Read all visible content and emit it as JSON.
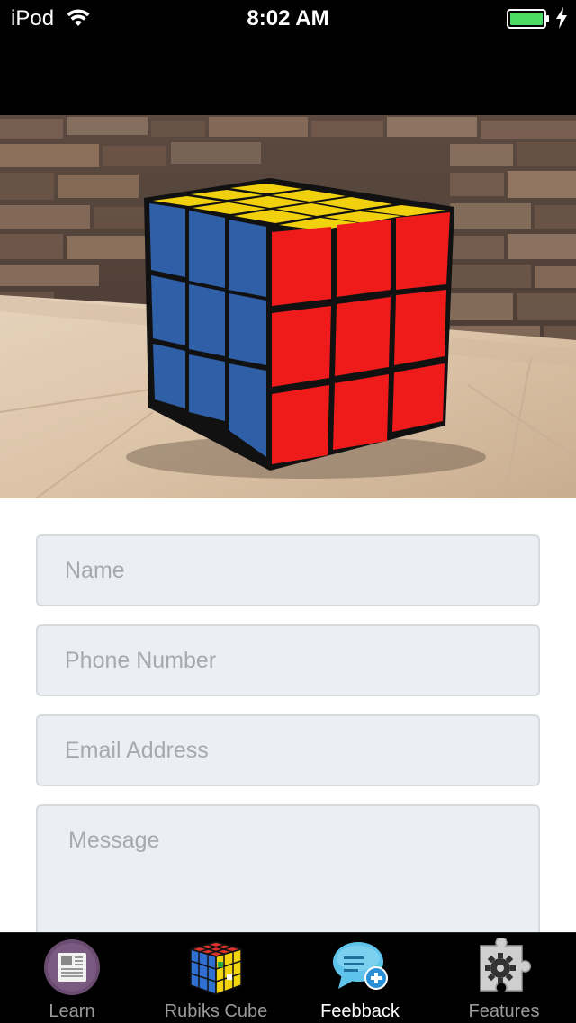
{
  "status_bar": {
    "carrier": "iPod",
    "time": "8:02 AM",
    "battery_color": "#4cd964"
  },
  "hero": {
    "image": "rubiks-cube-photo"
  },
  "form": {
    "name_placeholder": "Name",
    "phone_placeholder": "Phone Number",
    "email_placeholder": "Email Address",
    "message_placeholder": "Message"
  },
  "tabs": [
    {
      "label": "Learn",
      "icon": "newspaper-icon",
      "active": false
    },
    {
      "label": "Rubiks Cube",
      "icon": "rubiks-cube-icon",
      "active": false
    },
    {
      "label": "Feebback",
      "icon": "chat-bubble-plus-icon",
      "active": true
    },
    {
      "label": "Features",
      "icon": "puzzle-gear-icon",
      "active": false
    }
  ]
}
